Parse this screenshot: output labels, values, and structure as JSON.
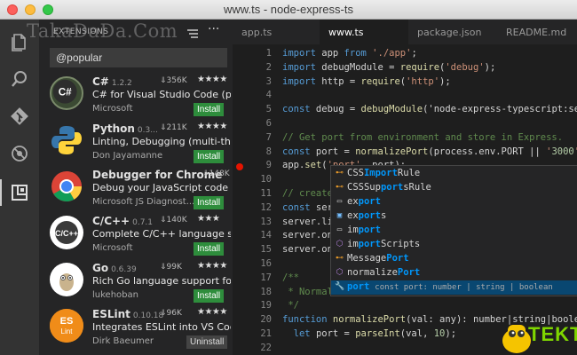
{
  "window": {
    "title": "www.ts - node-express-ts"
  },
  "activity_bar": {
    "icons": [
      "files-icon",
      "search-icon",
      "git-icon",
      "debug-icon",
      "extensions-icon"
    ]
  },
  "sidebar": {
    "watermark": "TakaDaDa.Com",
    "title": "EXTENSIONS",
    "search_value": "@popular",
    "extensions": [
      {
        "name": "C#",
        "version": "1.2.2",
        "downloads": "356K",
        "stars": "★★★★",
        "description": "C# for Visual Studio Code (po...",
        "author": "Microsoft",
        "action": "Install",
        "logo_color": "#3b4a33",
        "logo_text": "C#"
      },
      {
        "name": "Python",
        "version": "0.3...",
        "downloads": "211K",
        "stars": "★★★★",
        "description": "Linting, Debugging (multi-thr...",
        "author": "Don Jayamanne",
        "action": "Install",
        "logo_color": "#2f5c87",
        "logo_text": ""
      },
      {
        "name": "Debugger for Chrome",
        "version": "",
        "downloads": "148K",
        "stars": "",
        "description": "Debug your JavaScript code i...",
        "author": "Microsoft JS Diagnost...",
        "action": "Install",
        "logo_color": "#dddddd",
        "logo_text": ""
      },
      {
        "name": "C/C++",
        "version": "0.7.1",
        "downloads": "140K",
        "stars": "★★★",
        "description": "Complete C/C++ language su...",
        "author": "Microsoft",
        "action": "Install",
        "logo_color": "#7a2a4a",
        "logo_text": "C/C++"
      },
      {
        "name": "Go",
        "version": "0.6.39",
        "downloads": "99K",
        "stars": "★★★★",
        "description": "Rich Go language support fo...",
        "author": "lukehoban",
        "action": "Install",
        "logo_color": "#ffffff",
        "logo_text": ""
      },
      {
        "name": "ESLint",
        "version": "0.10.18",
        "downloads": "96K",
        "stars": "★★★★",
        "description": "Integrates ESLint into VS Code.",
        "author": "Dirk Baeumer",
        "action": "Uninstall",
        "logo_color": "#f08c19",
        "logo_text": "ES\nLint"
      }
    ]
  },
  "tabs": [
    {
      "label": "app.ts",
      "active": false
    },
    {
      "label": "www.ts",
      "active": true
    },
    {
      "label": "package.json",
      "active": false
    },
    {
      "label": "README.md",
      "active": false
    }
  ],
  "code_lines": [
    {
      "num": "1",
      "text": "import app from './app';"
    },
    {
      "num": "2",
      "text": "import debugModule = require('debug');"
    },
    {
      "num": "3",
      "text": "import http = require('http');"
    },
    {
      "num": "4",
      "text": ""
    },
    {
      "num": "5",
      "text": "const debug = debugModule('node-express-typescript:serv"
    },
    {
      "num": "6",
      "text": ""
    },
    {
      "num": "7",
      "text": "// Get port from environment and store in Express."
    },
    {
      "num": "8",
      "text": "const port = normalizePort(process.env.PORT || '3000');"
    },
    {
      "num": "9",
      "text": "app.set('port', port);"
    },
    {
      "num": "10",
      "text": ""
    },
    {
      "num": "11",
      "text": "// create"
    },
    {
      "num": "12",
      "text": "const ser"
    },
    {
      "num": "13",
      "text": "server.li"
    },
    {
      "num": "14",
      "text": "server.on"
    },
    {
      "num": "15",
      "text": "server.on"
    },
    {
      "num": "16",
      "text": ""
    },
    {
      "num": "17",
      "text": "/**"
    },
    {
      "num": "18",
      "text": " * Normal"
    },
    {
      "num": "19",
      "text": " */"
    },
    {
      "num": "20",
      "text": "function normalizePort(val: any): number|string|boolea"
    },
    {
      "num": "21",
      "text": "  let port = parseInt(val, 10);"
    },
    {
      "num": "22",
      "text": ""
    },
    {
      "num": "23",
      "text": "  if (isNaN(port)) {"
    }
  ],
  "suggest": {
    "items": [
      {
        "pre": "CSS",
        "match": "Import",
        "post": "Rule",
        "icon": "class-icon",
        "detail": "",
        "selected": false
      },
      {
        "pre": "CSSSup",
        "match": "port",
        "post": "sRule",
        "icon": "class-icon",
        "detail": "",
        "selected": false
      },
      {
        "pre": "ex",
        "match": "port",
        "post": "",
        "icon": "keyword-icon",
        "detail": "",
        "selected": false
      },
      {
        "pre": "ex",
        "match": "port",
        "post": "s",
        "icon": "variable-icon",
        "detail": "",
        "selected": false
      },
      {
        "pre": "im",
        "match": "port",
        "post": "",
        "icon": "keyword-icon",
        "detail": "",
        "selected": false
      },
      {
        "pre": "im",
        "match": "port",
        "post": "Scripts",
        "icon": "function-icon",
        "detail": "",
        "selected": false
      },
      {
        "pre": "Message",
        "match": "Port",
        "post": "",
        "icon": "class-icon",
        "detail": "",
        "selected": false
      },
      {
        "pre": "normalize",
        "match": "Port",
        "post": "",
        "icon": "function-icon",
        "detail": "",
        "selected": false
      },
      {
        "pre": "",
        "match": "port",
        "post": "",
        "icon": "wrench-icon",
        "detail": "const port: number | string | boolean",
        "selected": true
      }
    ]
  },
  "badge": {
    "text": "TEKT"
  }
}
